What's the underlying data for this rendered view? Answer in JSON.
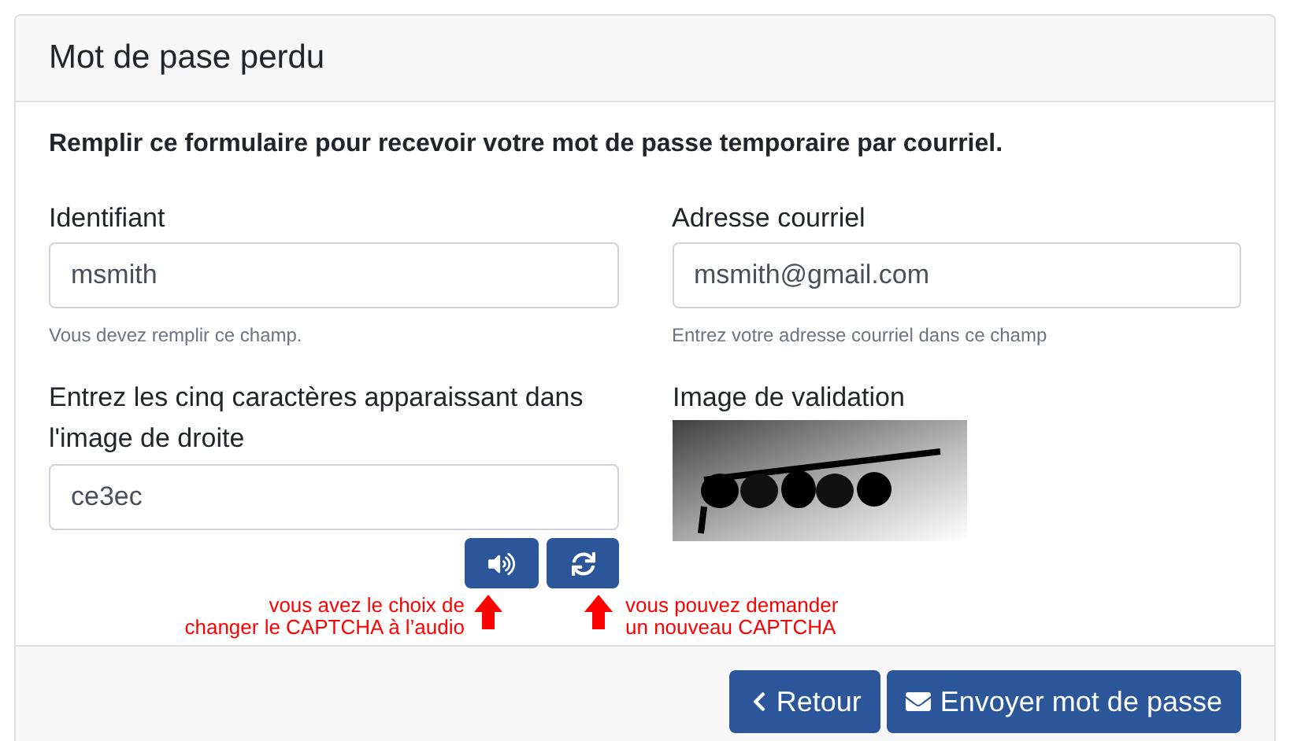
{
  "panel": {
    "title": "Mot de pase perdu"
  },
  "intro": "Remplir ce formulaire pour recevoir votre mot de passe temporaire par courriel.",
  "fields": [
    {
      "label": "Identifiant",
      "value": "msmith",
      "help": "Vous devez remplir ce champ."
    },
    {
      "label": "Adresse courriel",
      "value": "msmith@gmail.com",
      "help": "Entrez votre adresse courriel dans ce champ"
    }
  ],
  "captcha": {
    "label": "Entrez les cinq caractères apparaissant dans l'image de droite",
    "value": "ce3ec",
    "image_label": "Image de validation"
  },
  "annotations": [
    {
      "lines": [
        "vous avez le choix de",
        "changer le CAPTCHA à l’audio"
      ]
    },
    {
      "lines": [
        "vous pouvez demander",
        "un nouveau CAPTCHA"
      ]
    }
  ],
  "footer": {
    "buttons": [
      "Retour",
      "Envoyer mot de passe"
    ]
  }
}
